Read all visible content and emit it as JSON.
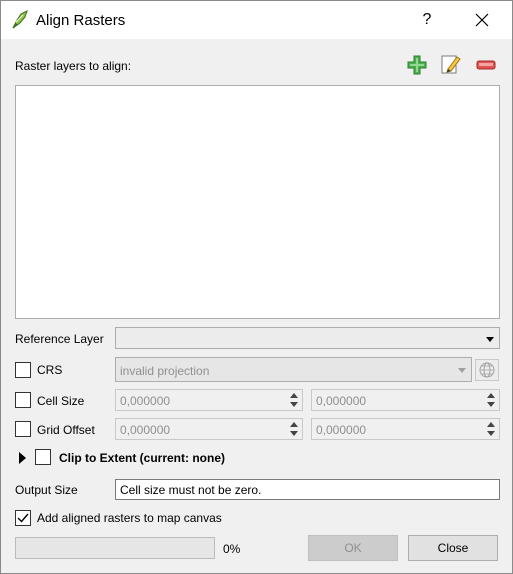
{
  "window": {
    "title": "Align Rasters",
    "help_label": "?"
  },
  "layers": {
    "label": "Raster layers to align:",
    "items": []
  },
  "reference_layer": {
    "label": "Reference Layer",
    "value": ""
  },
  "crs": {
    "label": "CRS",
    "checked": false,
    "value": "invalid projection"
  },
  "cell_size": {
    "label": "Cell Size",
    "checked": false,
    "x": "0,000000",
    "y": "0,000000"
  },
  "grid_offset": {
    "label": "Grid Offset",
    "checked": false,
    "x": "0,000000",
    "y": "0,000000"
  },
  "clip": {
    "label": "Clip to Extent (current: none)",
    "checked": false
  },
  "output_size": {
    "label": "Output Size",
    "value": "Cell size must not be zero."
  },
  "add_to_canvas": {
    "label": "Add aligned rasters to map canvas",
    "checked": true
  },
  "progress": {
    "value": 0,
    "label": "0%"
  },
  "buttons": {
    "ok": "OK",
    "close": "Close"
  },
  "icons": {
    "app": "qgis-align-icon",
    "add": "plus-icon",
    "edit": "pencil-icon",
    "remove": "minus-icon",
    "crs_select": "globe-icon",
    "close": "close-icon"
  },
  "colors": {
    "add_icon": "#3e9e3e",
    "remove_icon": "#e03c3c",
    "window_bg": "#f0f0f0"
  }
}
